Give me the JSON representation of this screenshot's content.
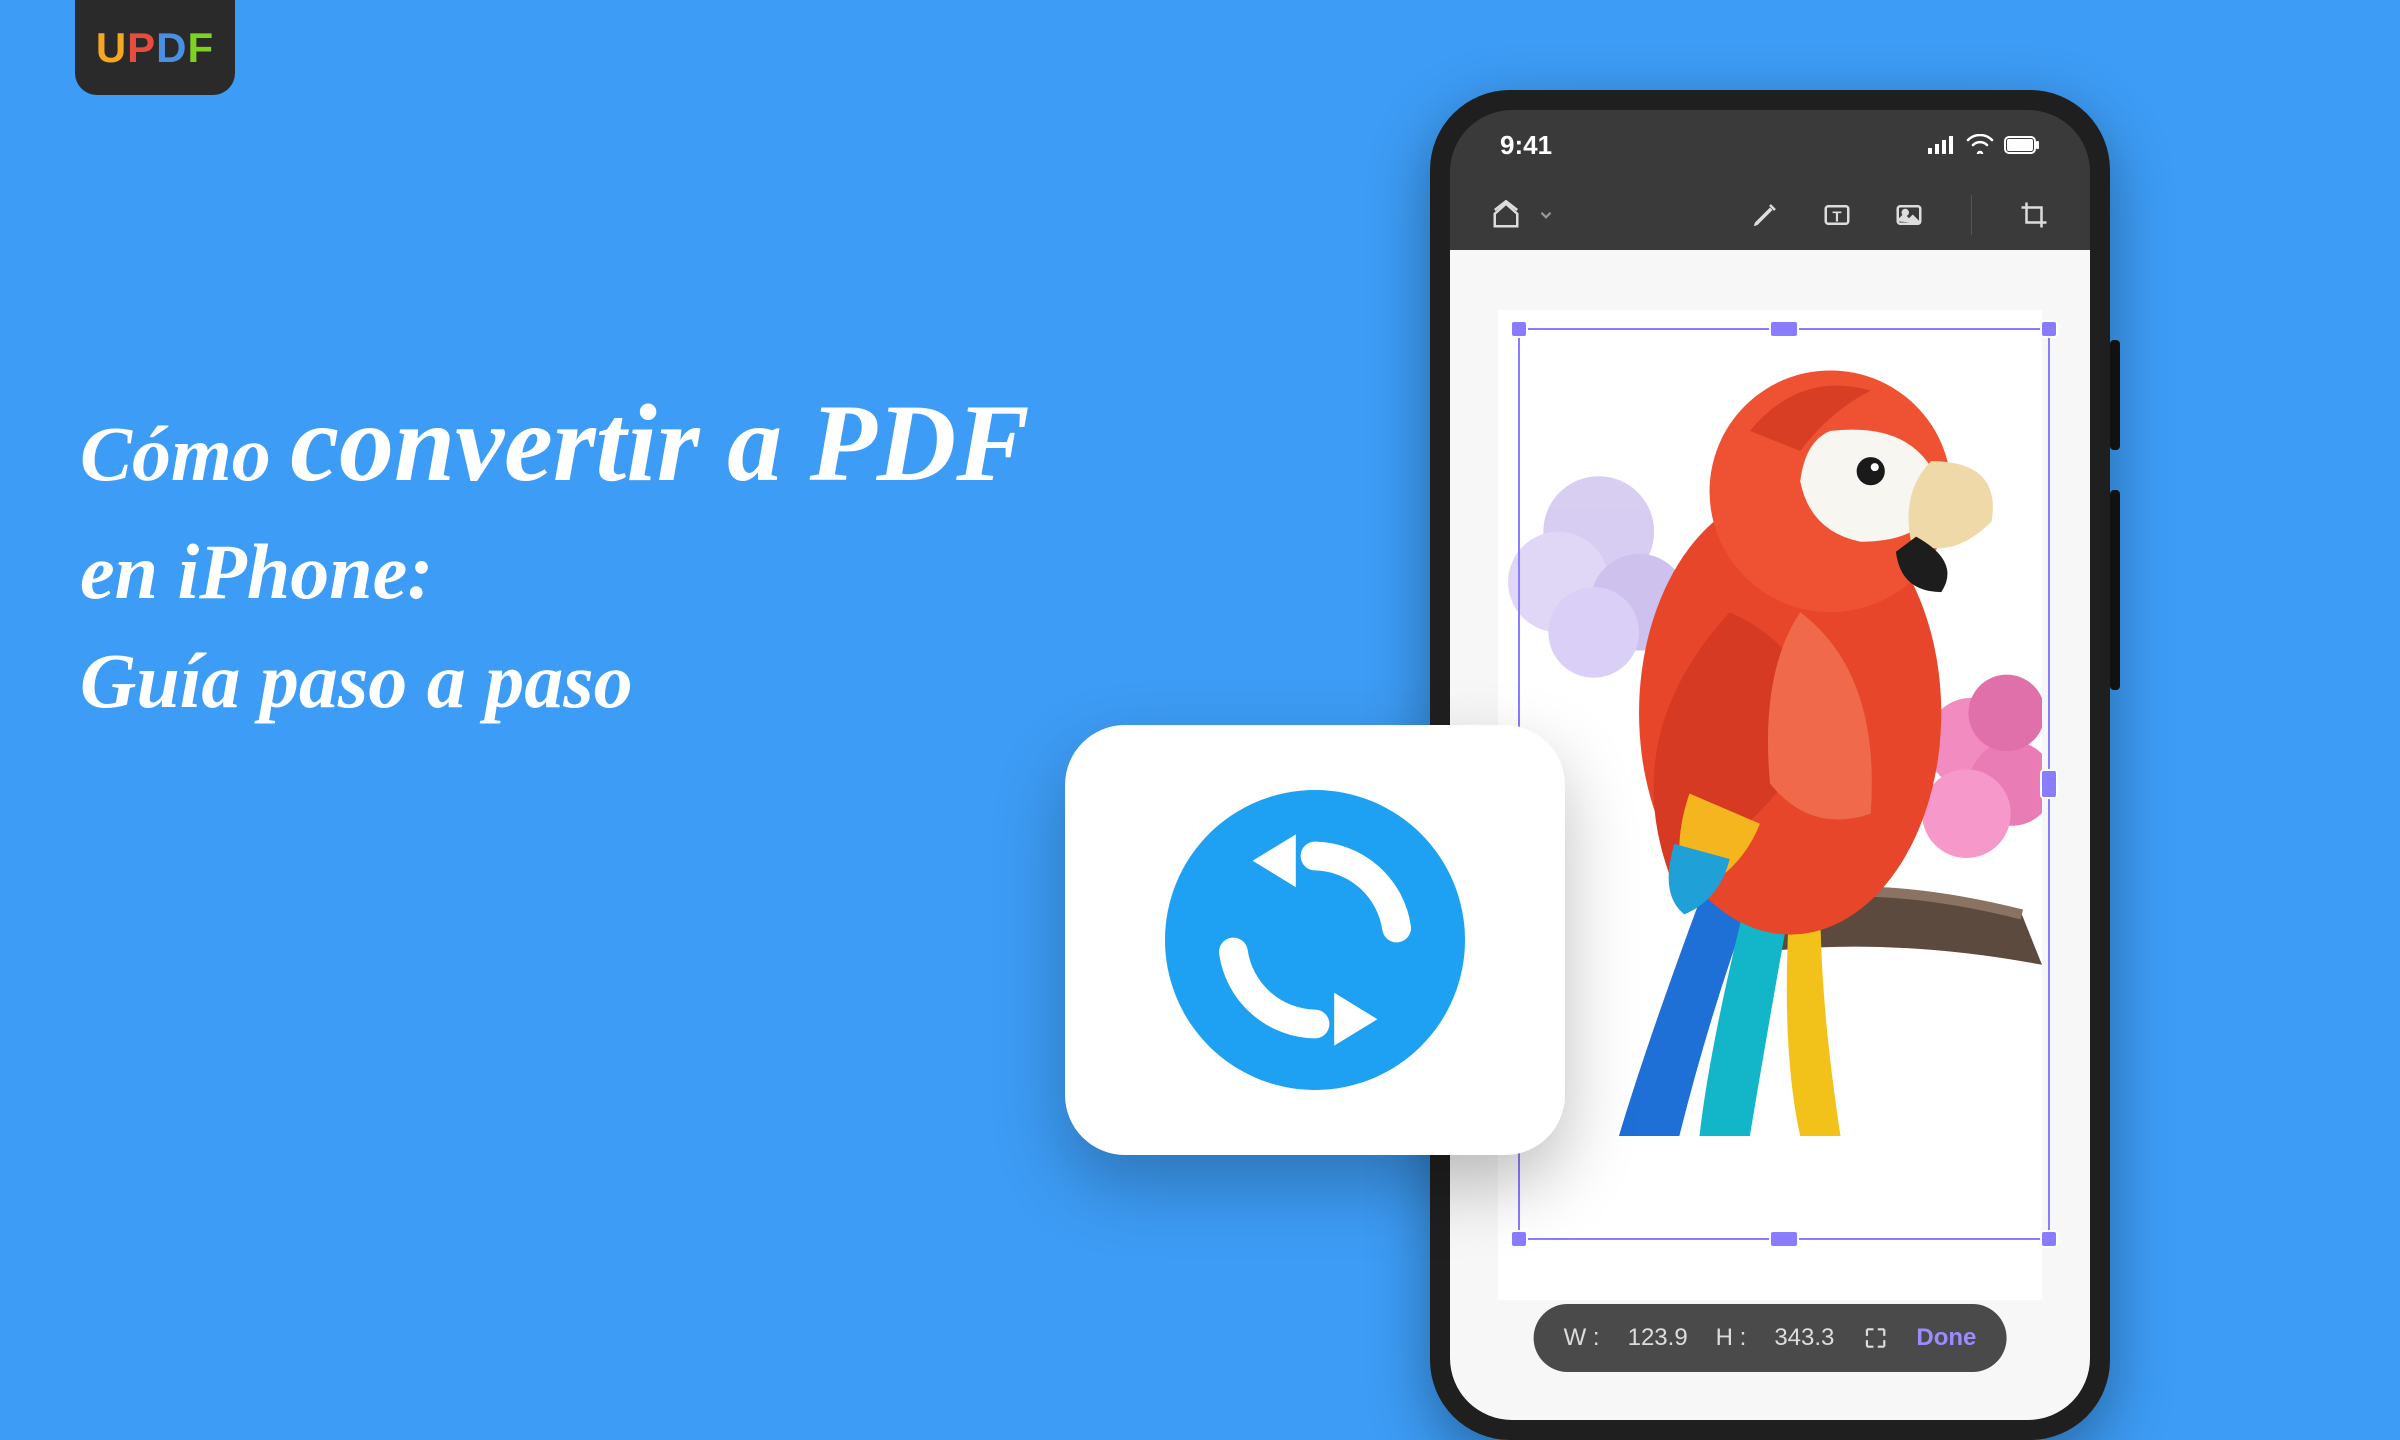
{
  "logo": {
    "u": "U",
    "p": "P",
    "d": "D",
    "f": "F"
  },
  "headline": {
    "line1_small": "Cómo ",
    "line1_big": "convertir a PDF",
    "line2": "en iPhone:",
    "line3": "Guía paso a paso"
  },
  "phone": {
    "status_time": "9:41",
    "size_bar": {
      "w_label": "W :",
      "w_value": "123.9",
      "h_label": "H :",
      "h_value": "343.3",
      "done_label": "Done"
    }
  }
}
